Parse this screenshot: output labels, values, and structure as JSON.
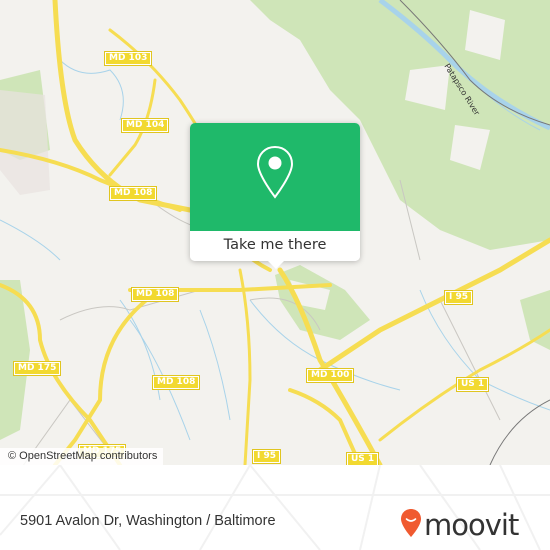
{
  "map": {
    "road_labels": [
      {
        "id": "md103",
        "text": "MD 103"
      },
      {
        "id": "md104",
        "text": "MD 104"
      },
      {
        "id": "md108a",
        "text": "MD 108"
      },
      {
        "id": "md108b",
        "text": "MD 108"
      },
      {
        "id": "md108c",
        "text": "MD 108"
      },
      {
        "id": "md175a",
        "text": "MD 175"
      },
      {
        "id": "md175b",
        "text": "MD 175"
      },
      {
        "id": "md100",
        "text": "MD 100"
      },
      {
        "id": "i95a",
        "text": "I 95"
      },
      {
        "id": "i95b",
        "text": "I 95"
      },
      {
        "id": "us1a",
        "text": "US 1"
      },
      {
        "id": "us1b",
        "text": "US 1"
      }
    ],
    "river_label": "Patapsco River",
    "attribution": "© OpenStreetMap contributors",
    "colors": {
      "land": "#f3f2ee",
      "park": "#c9e2b0",
      "water": "#a8d3ea",
      "road": "#f6dd52"
    }
  },
  "popup": {
    "button_label": "Take me there",
    "icon": "map-pin-icon",
    "color": "#1fb96a"
  },
  "footer": {
    "address": "5901 Avalon Dr, Washington / Baltimore",
    "logo_text": "moovit",
    "logo_color": "#f05a30"
  }
}
